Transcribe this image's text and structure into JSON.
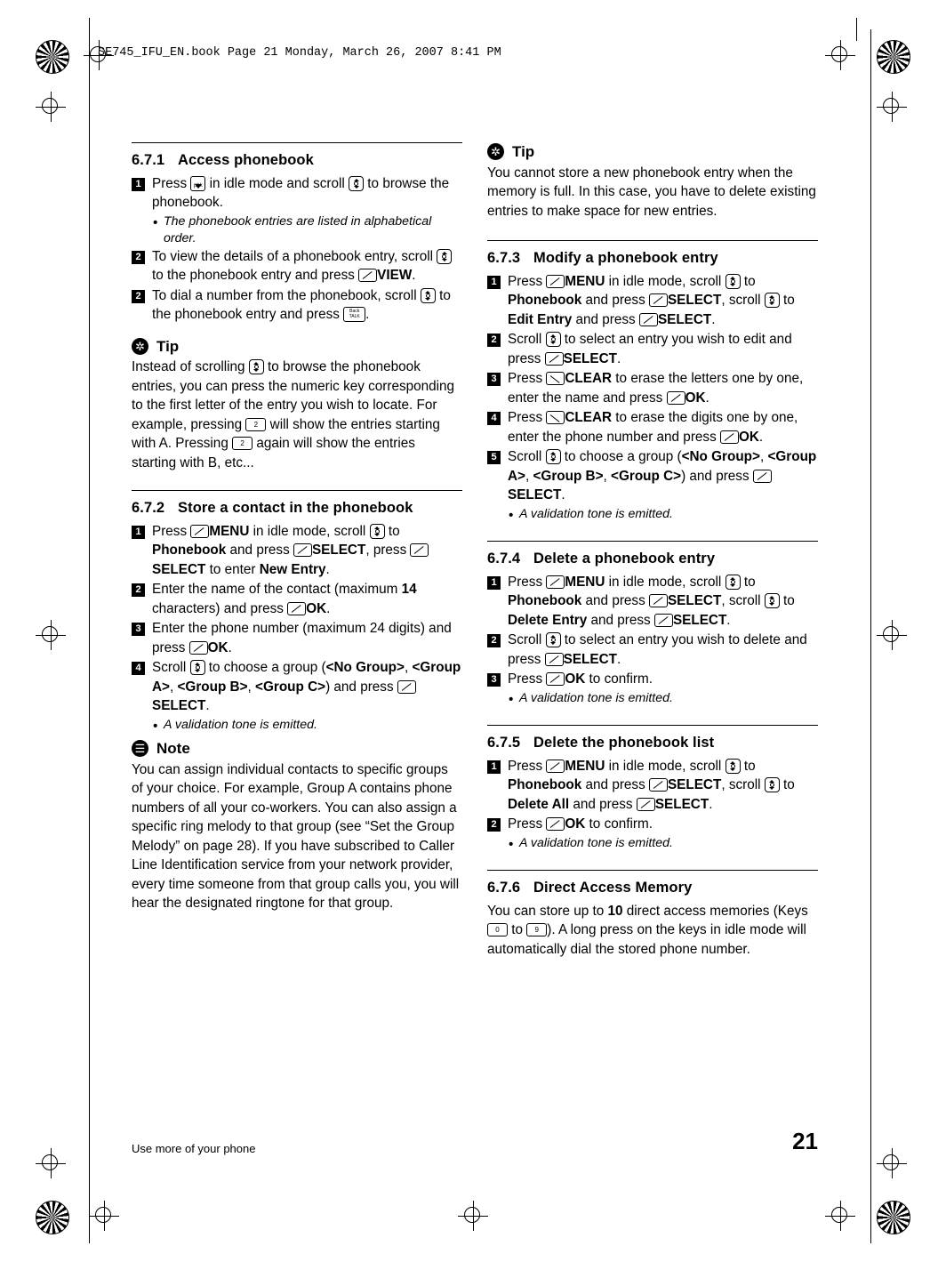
{
  "header": {
    "text": "SE745_IFU_EN.book  Page 21  Monday, March 26, 2007  8:41 PM"
  },
  "footer": {
    "running_title": "Use more of your phone",
    "page_number": "21"
  },
  "left_column": {
    "sections": [
      {
        "number": "6.7.1",
        "title": "Access phonebook",
        "steps": [
          {
            "n": "1",
            "parts": [
              {
                "t": "text",
                "v": "Press "
              },
              {
                "t": "key",
                "v": "pbk-key"
              },
              {
                "t": "text",
                "v": " in idle mode and scroll "
              },
              {
                "t": "key",
                "v": "nav-updown-key"
              },
              {
                "t": "text",
                "v": " to browse the phonebook."
              }
            ],
            "bullets": [
              "The phonebook entries are listed in alphabetical order."
            ]
          },
          {
            "n": "2",
            "parts": [
              {
                "t": "text",
                "v": "To view the details of a phonebook entry, scroll "
              },
              {
                "t": "key",
                "v": "nav-updown-key"
              },
              {
                "t": "text",
                "v": " to the phonebook entry and press "
              },
              {
                "t": "key",
                "v": "softkey-left"
              },
              {
                "t": "bold",
                "v": "VIEW"
              },
              {
                "t": "text",
                "v": "."
              }
            ],
            "bullets": []
          },
          {
            "n": "2",
            "parts": [
              {
                "t": "text",
                "v": "To dial a number from the phonebook, scroll "
              },
              {
                "t": "key",
                "v": "nav-updown-key"
              },
              {
                "t": "text",
                "v": " to the phonebook entry and press "
              },
              {
                "t": "key",
                "v": "talk-key"
              },
              {
                "t": "text",
                "v": "."
              }
            ],
            "bullets": []
          }
        ]
      }
    ],
    "tip1": {
      "label": "Tip",
      "body_parts": [
        {
          "t": "text",
          "v": "Instead of scrolling "
        },
        {
          "t": "key",
          "v": "nav-updown-key"
        },
        {
          "t": "text",
          "v": " to browse the phonebook entries, you can press the numeric key corresponding to the first letter of the entry you wish to locate. For example, pressing "
        },
        {
          "t": "key",
          "v": "key-2"
        },
        {
          "t": "text",
          "v": " will show the entries starting with A. Pressing "
        },
        {
          "t": "key",
          "v": "key-2"
        },
        {
          "t": "text",
          "v": " again will show the entries starting with B, etc..."
        }
      ]
    },
    "section_672": {
      "number": "6.7.2",
      "title": "Store a contact in the phonebook",
      "steps": [
        {
          "n": "1",
          "parts": [
            {
              "t": "text",
              "v": "Press "
            },
            {
              "t": "key",
              "v": "softkey-left"
            },
            {
              "t": "bold",
              "v": "MENU"
            },
            {
              "t": "text",
              "v": " in idle mode, scroll "
            },
            {
              "t": "key",
              "v": "nav-updown-key"
            },
            {
              "t": "text",
              "v": " to "
            },
            {
              "t": "bold",
              "v": "Phonebook"
            },
            {
              "t": "text",
              "v": " and press "
            },
            {
              "t": "key",
              "v": "softkey-left"
            },
            {
              "t": "bold",
              "v": "SELECT"
            },
            {
              "t": "text",
              "v": ", press "
            },
            {
              "t": "key",
              "v": "softkey-left"
            },
            {
              "t": "bold",
              "v": "SELECT"
            },
            {
              "t": "text",
              "v": " to enter "
            },
            {
              "t": "bold",
              "v": "New Entry"
            },
            {
              "t": "text",
              "v": "."
            }
          ],
          "bullets": []
        },
        {
          "n": "2",
          "parts": [
            {
              "t": "text",
              "v": "Enter the name of the contact (maximum "
            },
            {
              "t": "bold",
              "v": "14"
            },
            {
              "t": "text",
              "v": " characters) and press "
            },
            {
              "t": "key",
              "v": "softkey-left"
            },
            {
              "t": "bold",
              "v": "OK"
            },
            {
              "t": "text",
              "v": "."
            }
          ],
          "bullets": []
        },
        {
          "n": "3",
          "parts": [
            {
              "t": "text",
              "v": "Enter the phone number (maximum 24 digits) and press "
            },
            {
              "t": "key",
              "v": "softkey-left"
            },
            {
              "t": "bold",
              "v": "OK"
            },
            {
              "t": "text",
              "v": "."
            }
          ],
          "bullets": []
        },
        {
          "n": "4",
          "parts": [
            {
              "t": "text",
              "v": "Scroll "
            },
            {
              "t": "key",
              "v": "nav-updown-key"
            },
            {
              "t": "text",
              "v": " to choose a group ("
            },
            {
              "t": "bold",
              "v": "<No Group>"
            },
            {
              "t": "text",
              "v": ", "
            },
            {
              "t": "bold",
              "v": "<Group A>"
            },
            {
              "t": "text",
              "v": ", "
            },
            {
              "t": "bold",
              "v": "<Group B>"
            },
            {
              "t": "text",
              "v": ", "
            },
            {
              "t": "bold",
              "v": "<Group C>"
            },
            {
              "t": "text",
              "v": ") and press "
            },
            {
              "t": "key",
              "v": "softkey-left"
            },
            {
              "t": "bold",
              "v": "SELECT"
            },
            {
              "t": "text",
              "v": "."
            }
          ],
          "bullets": [
            "A validation tone is emitted."
          ]
        }
      ]
    },
    "note": {
      "label": "Note",
      "body": "You can assign individual contacts to specific groups of your choice. For example, Group A contains phone numbers of all your co-workers. You can also assign a specific ring melody to that group (see “Set the Group Melody” on page 28). If you have subscribed to Caller Line Identification service from your network provider, every time someone from that group calls you, you will hear the designated ringtone for that group."
    }
  },
  "right_column": {
    "tip2": {
      "label": "Tip",
      "body": "You cannot store a new phonebook entry when the memory is full. In this case, you have to delete existing entries to make space for new entries."
    },
    "section_673": {
      "number": "6.7.3",
      "title": "Modify a phonebook entry",
      "steps": [
        {
          "n": "1",
          "parts": [
            {
              "t": "text",
              "v": "Press "
            },
            {
              "t": "key",
              "v": "softkey-left"
            },
            {
              "t": "bold",
              "v": "MENU"
            },
            {
              "t": "text",
              "v": " in idle mode, scroll "
            },
            {
              "t": "key",
              "v": "nav-updown-key"
            },
            {
              "t": "text",
              "v": " to "
            },
            {
              "t": "bold",
              "v": "Phonebook"
            },
            {
              "t": "text",
              "v": " and press "
            },
            {
              "t": "key",
              "v": "softkey-left"
            },
            {
              "t": "bold",
              "v": "SELECT"
            },
            {
              "t": "text",
              "v": ", scroll "
            },
            {
              "t": "key",
              "v": "nav-updown-key"
            },
            {
              "t": "text",
              "v": " to "
            },
            {
              "t": "bold",
              "v": "Edit Entry"
            },
            {
              "t": "text",
              "v": " and press "
            },
            {
              "t": "key",
              "v": "softkey-left"
            },
            {
              "t": "bold",
              "v": "SELECT"
            },
            {
              "t": "text",
              "v": "."
            }
          ],
          "bullets": []
        },
        {
          "n": "2",
          "parts": [
            {
              "t": "text",
              "v": "Scroll "
            },
            {
              "t": "key",
              "v": "nav-updown-key"
            },
            {
              "t": "text",
              "v": " to select an entry you wish to edit and press "
            },
            {
              "t": "key",
              "v": "softkey-left"
            },
            {
              "t": "bold",
              "v": "SELECT"
            },
            {
              "t": "text",
              "v": "."
            }
          ],
          "bullets": []
        },
        {
          "n": "3",
          "parts": [
            {
              "t": "text",
              "v": "Press "
            },
            {
              "t": "key",
              "v": "softkey-right"
            },
            {
              "t": "bold",
              "v": "CLEAR"
            },
            {
              "t": "text",
              "v": " to erase the letters one by one, enter the name and press "
            },
            {
              "t": "key",
              "v": "softkey-left"
            },
            {
              "t": "bold",
              "v": "OK"
            },
            {
              "t": "text",
              "v": "."
            }
          ],
          "bullets": []
        },
        {
          "n": "4",
          "parts": [
            {
              "t": "text",
              "v": "Press "
            },
            {
              "t": "key",
              "v": "softkey-right"
            },
            {
              "t": "bold",
              "v": "CLEAR"
            },
            {
              "t": "text",
              "v": " to erase the digits one by one, enter the phone number and press "
            },
            {
              "t": "key",
              "v": "softkey-left"
            },
            {
              "t": "bold",
              "v": "OK"
            },
            {
              "t": "text",
              "v": "."
            }
          ],
          "bullets": []
        },
        {
          "n": "5",
          "parts": [
            {
              "t": "text",
              "v": "Scroll "
            },
            {
              "t": "key",
              "v": "nav-updown-key"
            },
            {
              "t": "text",
              "v": " to choose a group ("
            },
            {
              "t": "bold",
              "v": "<No Group>"
            },
            {
              "t": "text",
              "v": ", "
            },
            {
              "t": "bold",
              "v": "<Group A>"
            },
            {
              "t": "text",
              "v": ", "
            },
            {
              "t": "bold",
              "v": "<Group B>"
            },
            {
              "t": "text",
              "v": ", "
            },
            {
              "t": "bold",
              "v": "<Group C>"
            },
            {
              "t": "text",
              "v": ") and press "
            },
            {
              "t": "key",
              "v": "softkey-left"
            },
            {
              "t": "bold",
              "v": "SELECT"
            },
            {
              "t": "text",
              "v": "."
            }
          ],
          "bullets": [
            "A validation tone is emitted."
          ]
        }
      ]
    },
    "section_674": {
      "number": "6.7.4",
      "title": "Delete a phonebook entry",
      "steps": [
        {
          "n": "1",
          "parts": [
            {
              "t": "text",
              "v": "Press "
            },
            {
              "t": "key",
              "v": "softkey-left"
            },
            {
              "t": "bold",
              "v": "MENU"
            },
            {
              "t": "text",
              "v": " in idle mode, scroll "
            },
            {
              "t": "key",
              "v": "nav-updown-key"
            },
            {
              "t": "text",
              "v": " to "
            },
            {
              "t": "bold",
              "v": "Phonebook"
            },
            {
              "t": "text",
              "v": " and press "
            },
            {
              "t": "key",
              "v": "softkey-left"
            },
            {
              "t": "bold",
              "v": "SELECT"
            },
            {
              "t": "text",
              "v": ", scroll "
            },
            {
              "t": "key",
              "v": "nav-updown-key"
            },
            {
              "t": "text",
              "v": " to "
            },
            {
              "t": "bold",
              "v": "Delete Entry"
            },
            {
              "t": "text",
              "v": " and press "
            },
            {
              "t": "key",
              "v": "softkey-left"
            },
            {
              "t": "bold",
              "v": "SELECT"
            },
            {
              "t": "text",
              "v": "."
            }
          ],
          "bullets": []
        },
        {
          "n": "2",
          "parts": [
            {
              "t": "text",
              "v": "Scroll "
            },
            {
              "t": "key",
              "v": "nav-updown-key"
            },
            {
              "t": "text",
              "v": " to select an entry you wish to delete and press "
            },
            {
              "t": "key",
              "v": "softkey-left"
            },
            {
              "t": "bold",
              "v": "SELECT"
            },
            {
              "t": "text",
              "v": "."
            }
          ],
          "bullets": []
        },
        {
          "n": "3",
          "parts": [
            {
              "t": "text",
              "v": "Press "
            },
            {
              "t": "key",
              "v": "softkey-left"
            },
            {
              "t": "bold",
              "v": "OK"
            },
            {
              "t": "text",
              "v": " to confirm."
            }
          ],
          "bullets": [
            "A validation tone is emitted."
          ]
        }
      ]
    },
    "section_675": {
      "number": "6.7.5",
      "title": "Delete the phonebook list",
      "steps": [
        {
          "n": "1",
          "parts": [
            {
              "t": "text",
              "v": "Press "
            },
            {
              "t": "key",
              "v": "softkey-left"
            },
            {
              "t": "bold",
              "v": "MENU"
            },
            {
              "t": "text",
              "v": " in idle mode, scroll "
            },
            {
              "t": "key",
              "v": "nav-updown-key"
            },
            {
              "t": "text",
              "v": " to "
            },
            {
              "t": "bold",
              "v": "Phonebook"
            },
            {
              "t": "text",
              "v": " and press "
            },
            {
              "t": "key",
              "v": "softkey-left"
            },
            {
              "t": "bold",
              "v": "SELECT"
            },
            {
              "t": "text",
              "v": ", scroll "
            },
            {
              "t": "key",
              "v": "nav-updown-key"
            },
            {
              "t": "text",
              "v": " to "
            },
            {
              "t": "bold",
              "v": "Delete All"
            },
            {
              "t": "text",
              "v": " and press "
            },
            {
              "t": "key",
              "v": "softkey-left"
            },
            {
              "t": "bold",
              "v": "SELECT"
            },
            {
              "t": "text",
              "v": "."
            }
          ],
          "bullets": []
        },
        {
          "n": "2",
          "parts": [
            {
              "t": "text",
              "v": "Press "
            },
            {
              "t": "key",
              "v": "softkey-left"
            },
            {
              "t": "bold",
              "v": "OK"
            },
            {
              "t": "text",
              "v": " to confirm."
            }
          ],
          "bullets": [
            "A validation tone is emitted."
          ]
        }
      ]
    },
    "section_676": {
      "number": "6.7.6",
      "title": "Direct Access Memory",
      "body_parts": [
        {
          "t": "text",
          "v": "You can store up to "
        },
        {
          "t": "bold",
          "v": "10"
        },
        {
          "t": "text",
          "v": " direct access memories (Keys "
        },
        {
          "t": "key",
          "v": "key-0"
        },
        {
          "t": "text",
          "v": " to "
        },
        {
          "t": "key",
          "v": "key-9"
        },
        {
          "t": "text",
          "v": "). A long press on the keys in idle mode will automatically dial the stored phone number."
        }
      ]
    }
  },
  "keys": {
    "key-0": "0",
    "key-2": "2",
    "key-9": "9",
    "pbk-key": "pbk",
    "talk-key": "Back TALK"
  }
}
